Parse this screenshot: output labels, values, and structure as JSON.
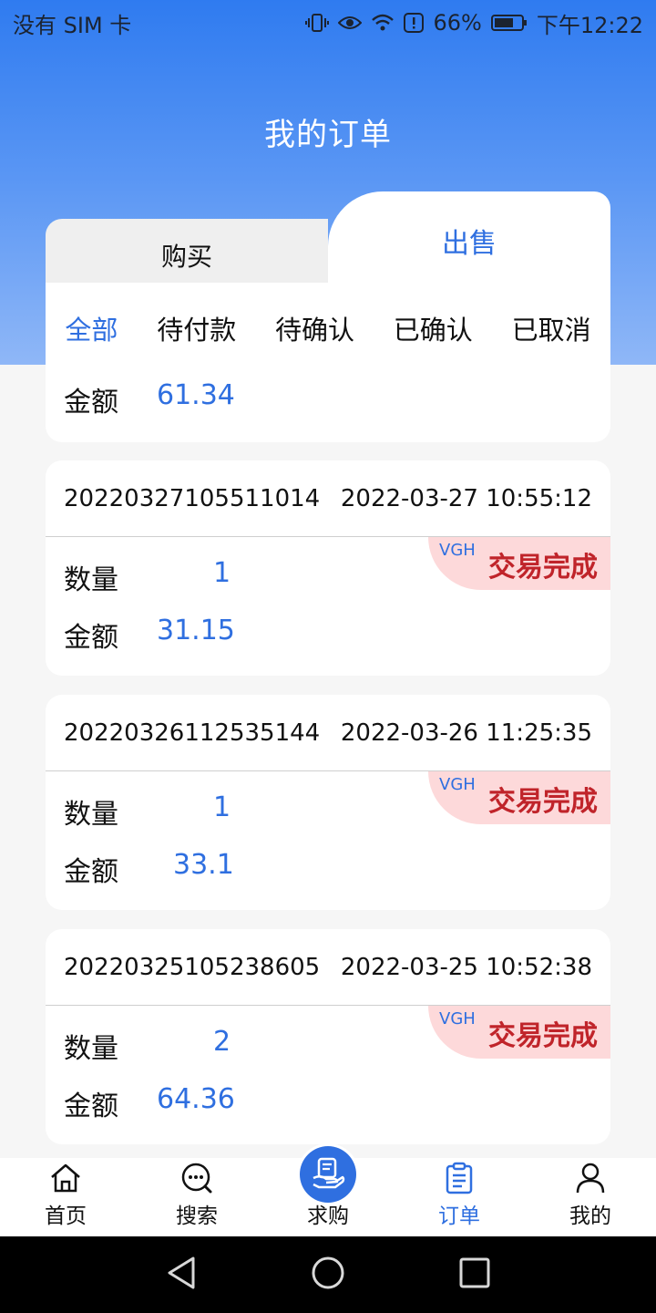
{
  "status_bar": {
    "carrier": "没有 SIM 卡",
    "battery": "66%",
    "time": "下午12:22"
  },
  "header": {
    "title": "我的订单"
  },
  "tabs": [
    {
      "label": "购买",
      "active": false
    },
    {
      "label": "出售",
      "active": true
    }
  ],
  "filters": [
    "全部",
    "待付款",
    "待确认",
    "已确认",
    "已取消"
  ],
  "partial_order": {
    "amount_label": "金额",
    "amount": "61.34"
  },
  "orders": [
    {
      "id": "20220327105511014",
      "time": "2022-03-27 10:55:12",
      "coin": "VGH",
      "status": "交易完成",
      "qty_label": "数量",
      "qty": "1",
      "amount_label": "金额",
      "amount": "31.15"
    },
    {
      "id": "20220326112535144",
      "time": "2022-03-26 11:25:35",
      "coin": "VGH",
      "status": "交易完成",
      "qty_label": "数量",
      "qty": "1",
      "amount_label": "金额",
      "amount": "33.1"
    },
    {
      "id": "20220325105238605",
      "time": "2022-03-25 10:52:38",
      "coin": "VGH",
      "status": "交易完成",
      "qty_label": "数量",
      "qty": "2",
      "amount_label": "金额",
      "amount": "64.36"
    }
  ],
  "bottom_nav": [
    {
      "label": "首页",
      "icon": "home-icon",
      "active": false
    },
    {
      "label": "搜索",
      "icon": "search-chat-icon",
      "active": false
    },
    {
      "label": "求购",
      "icon": "purchase-hand-icon",
      "active": false
    },
    {
      "label": "订单",
      "icon": "clipboard-icon",
      "active": true
    },
    {
      "label": "我的",
      "icon": "user-icon",
      "active": false
    }
  ],
  "colors": {
    "accent": "#2f6fe0",
    "status_red": "#c0242a",
    "badge_bg": "#fdd9da"
  }
}
